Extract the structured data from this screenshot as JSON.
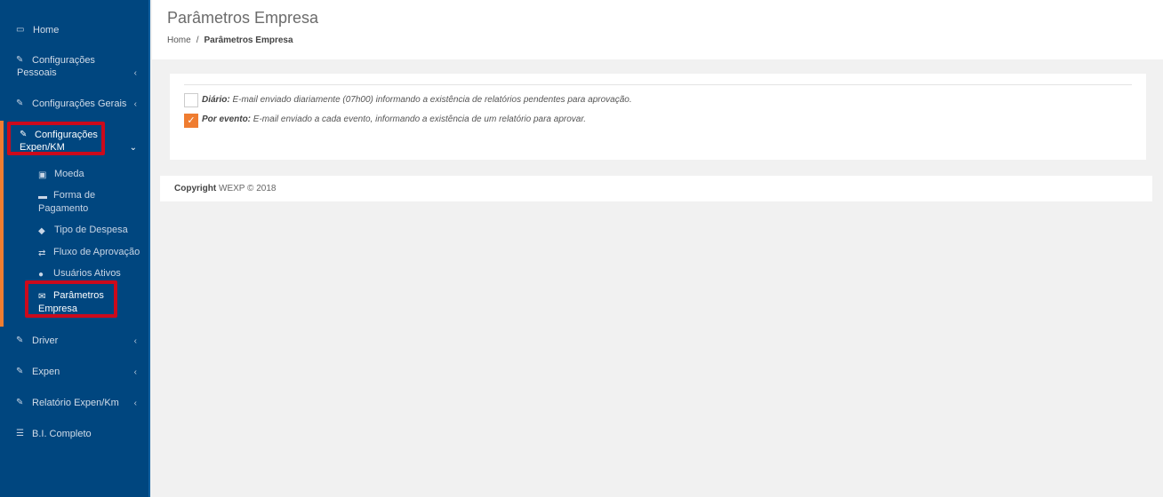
{
  "sidebar": {
    "home": "Home",
    "config_pessoais_1": "Configurações",
    "config_pessoais_2": "Pessoais",
    "config_gerais": "Configurações Gerais",
    "config_expen_1": "Configurações",
    "config_expen_2": "Expen/KM",
    "moeda": "Moeda",
    "forma_1": "Forma de",
    "forma_2": "Pagamento",
    "tipo_despesa": "Tipo de Despesa",
    "fluxo": "Fluxo de Aprovação",
    "usuarios": "Usuários Ativos",
    "parametros_1": "Parâmetros",
    "parametros_2": "Empresa",
    "driver": "Driver",
    "expen": "Expen",
    "relatorio": "Relatório Expen/Km",
    "bi": "B.I. Completo"
  },
  "header": {
    "title": "Parâmetros Empresa",
    "breadcrumb_home": "Home",
    "breadcrumb_sep": "/",
    "breadcrumb_current": "Parâmetros Empresa"
  },
  "options": {
    "diario_label": "Diário:",
    "diario_text": "E-mail enviado diariamente (07h00) informando a existência de relatórios pendentes para aprovação.",
    "diario_checked": false,
    "evento_label": "Por evento:",
    "evento_text": "E-mail enviado a cada evento, informando a existência de um relatório para aprovar.",
    "evento_checked": true
  },
  "footer": {
    "copyright_label": "Copyright",
    "copyright_text": "WEXP © 2018"
  },
  "colors": {
    "sidebar_bg": "#00467f",
    "accent": "#ef7d31",
    "highlight_box": "#cc0a1c"
  }
}
